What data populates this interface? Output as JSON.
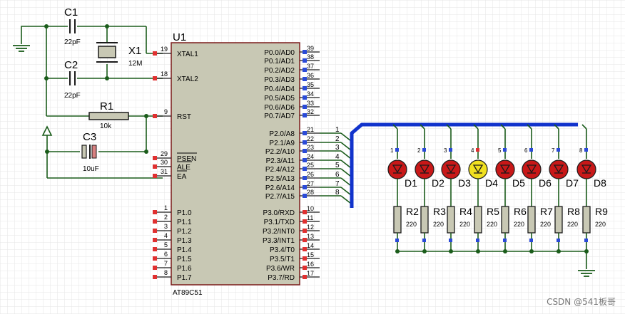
{
  "chip": {
    "ref": "U1",
    "part": "AT89C51",
    "left_pins": [
      {
        "num": "19",
        "name": "XTAL1"
      },
      {
        "num": "18",
        "name": "XTAL2"
      },
      {
        "num": "9",
        "name": "RST"
      },
      {
        "num": "29",
        "name": "PSEN"
      },
      {
        "num": "30",
        "name": "ALE"
      },
      {
        "num": "31",
        "name": "EA"
      },
      {
        "num": "1",
        "name": "P1.0"
      },
      {
        "num": "2",
        "name": "P1.1"
      },
      {
        "num": "3",
        "name": "P1.2"
      },
      {
        "num": "4",
        "name": "P1.3"
      },
      {
        "num": "5",
        "name": "P1.4"
      },
      {
        "num": "6",
        "name": "P1.5"
      },
      {
        "num": "7",
        "name": "P1.6"
      },
      {
        "num": "8",
        "name": "P1.7"
      }
    ],
    "right_pins": [
      {
        "num": "39",
        "name": "P0.0/AD0"
      },
      {
        "num": "38",
        "name": "P0.1/AD1"
      },
      {
        "num": "37",
        "name": "P0.2/AD2"
      },
      {
        "num": "36",
        "name": "P0.3/AD3"
      },
      {
        "num": "35",
        "name": "P0.4/AD4"
      },
      {
        "num": "34",
        "name": "P0.5/AD5"
      },
      {
        "num": "33",
        "name": "P0.6/AD6"
      },
      {
        "num": "32",
        "name": "P0.7/AD7"
      },
      {
        "num": "21",
        "name": "P2.0/A8"
      },
      {
        "num": "22",
        "name": "P2.1/A9"
      },
      {
        "num": "23",
        "name": "P2.2/A10"
      },
      {
        "num": "24",
        "name": "P2.3/A11"
      },
      {
        "num": "25",
        "name": "P2.4/A12"
      },
      {
        "num": "26",
        "name": "P2.5/A13"
      },
      {
        "num": "27",
        "name": "P2.6/A14"
      },
      {
        "num": "28",
        "name": "P2.7/A15"
      },
      {
        "num": "10",
        "name": "P3.0/RXD"
      },
      {
        "num": "11",
        "name": "P3.1/TXD"
      },
      {
        "num": "12",
        "name": "P3.2/INT0"
      },
      {
        "num": "13",
        "name": "P3.3/INT1"
      },
      {
        "num": "14",
        "name": "P3.4/T0"
      },
      {
        "num": "15",
        "name": "P3.5/T1"
      },
      {
        "num": "16",
        "name": "P3.6/WR"
      },
      {
        "num": "17",
        "name": "P3.7/RD"
      }
    ]
  },
  "components": {
    "c1": {
      "ref": "C1",
      "value": "22pF"
    },
    "c2": {
      "ref": "C2",
      "value": "22pF"
    },
    "x1": {
      "ref": "X1",
      "value": "12M"
    },
    "r1": {
      "ref": "R1",
      "value": "10k"
    },
    "c3": {
      "ref": "C3",
      "value": "10uF"
    }
  },
  "bus_numbers": [
    "1",
    "2",
    "3",
    "4",
    "5",
    "6",
    "7",
    "8"
  ],
  "leds": [
    {
      "ref": "D1",
      "pin": "1",
      "lit": false
    },
    {
      "ref": "D2",
      "pin": "2",
      "lit": false
    },
    {
      "ref": "D3",
      "pin": "3",
      "lit": false
    },
    {
      "ref": "D4",
      "pin": "4",
      "lit": true
    },
    {
      "ref": "D5",
      "pin": "5",
      "lit": false
    },
    {
      "ref": "D6",
      "pin": "6",
      "lit": false
    },
    {
      "ref": "D7",
      "pin": "7",
      "lit": false
    },
    {
      "ref": "D8",
      "pin": "8",
      "lit": false
    }
  ],
  "resistors": [
    {
      "ref": "R2",
      "value": "220"
    },
    {
      "ref": "R3",
      "value": "220"
    },
    {
      "ref": "R4",
      "value": "220"
    },
    {
      "ref": "R5",
      "value": "220"
    },
    {
      "ref": "R6",
      "value": "220"
    },
    {
      "ref": "R7",
      "value": "220"
    },
    {
      "ref": "R8",
      "value": "220"
    },
    {
      "ref": "R9",
      "value": "220"
    }
  ],
  "watermark": "CSDN @541板哥",
  "colors": {
    "wire": "#1a5c1a",
    "bus": "#1133cc",
    "chip_fill": "#c8c8b4",
    "chip_border": "#7a1a1a",
    "led_off": "#c81818",
    "led_on": "#f0e020",
    "resistor_fill": "#c8c8b4"
  }
}
